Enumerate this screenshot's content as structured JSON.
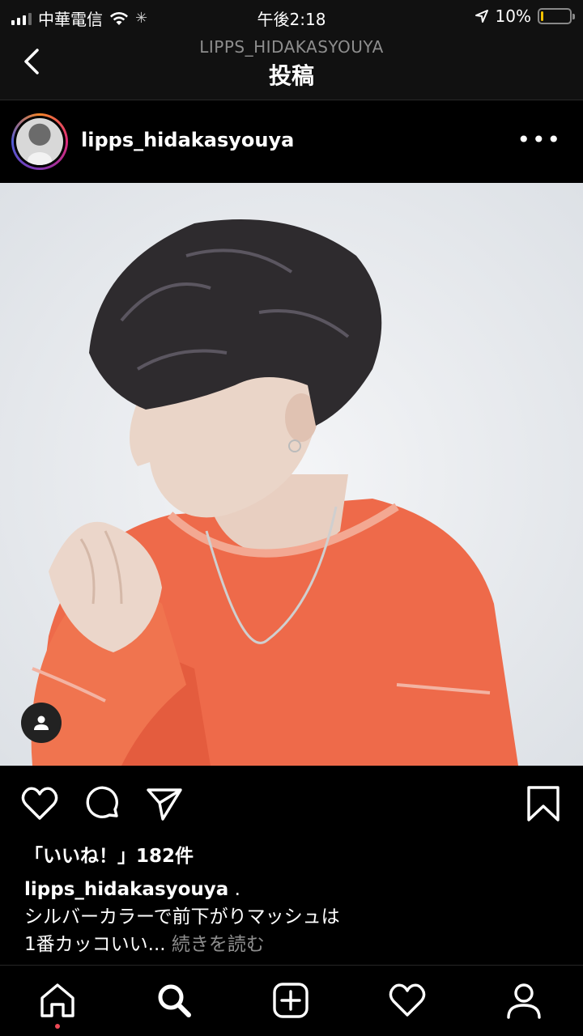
{
  "status_bar": {
    "carrier": "中華電信",
    "time": "午後2:18",
    "battery_percent_label": "10%",
    "battery_level": 0.1,
    "battery_color": "#f2c200"
  },
  "nav": {
    "subtitle": "LIPPS_HIDAKASYOUYA",
    "title": "投稿",
    "back_icon": "chevron-left-icon"
  },
  "post": {
    "username": "lipps_hidakasyouya",
    "more_icon": "ellipsis-icon",
    "photo_description_icon": "user-tag-icon",
    "likes": "「いいね！」182件",
    "caption_user": "lipps_hidakasyouya",
    "caption_line1_rest": " .",
    "caption_line2": "シルバーカラーで前下がりマッシュは",
    "caption_line3": "1番カッコいい...",
    "more_label": "続きを読む"
  },
  "actions": {
    "like_icon": "heart-icon",
    "comment_icon": "comment-icon",
    "share_icon": "paper-plane-icon",
    "save_icon": "bookmark-icon"
  },
  "tabbar": {
    "items": [
      "home-icon",
      "search-icon",
      "add-icon",
      "activity-icon",
      "profile-icon"
    ]
  },
  "colors": {
    "accent_dot": "#ed4956",
    "secondary_text": "#8e8e8e"
  }
}
